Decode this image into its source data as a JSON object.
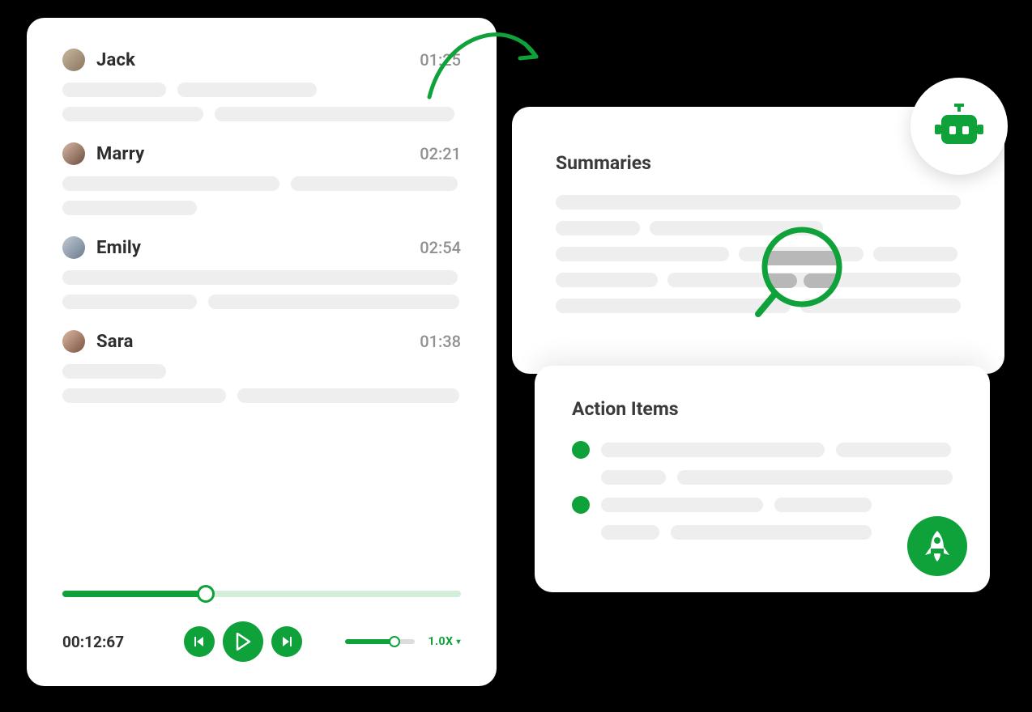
{
  "colors": {
    "accent": "#0fa13a"
  },
  "transcript": {
    "entries": [
      {
        "speaker": "Jack",
        "time": "01:25"
      },
      {
        "speaker": "Marry",
        "time": "02:21"
      },
      {
        "speaker": "Emily",
        "time": "02:54"
      },
      {
        "speaker": "Sara",
        "time": "01:38"
      }
    ],
    "player": {
      "elapsed": "00:12:67",
      "progress_pct": 36,
      "volume_pct": 70,
      "speed": "1.0X"
    }
  },
  "summaries": {
    "title": "Summaries"
  },
  "action_items": {
    "title": "Action Items"
  }
}
